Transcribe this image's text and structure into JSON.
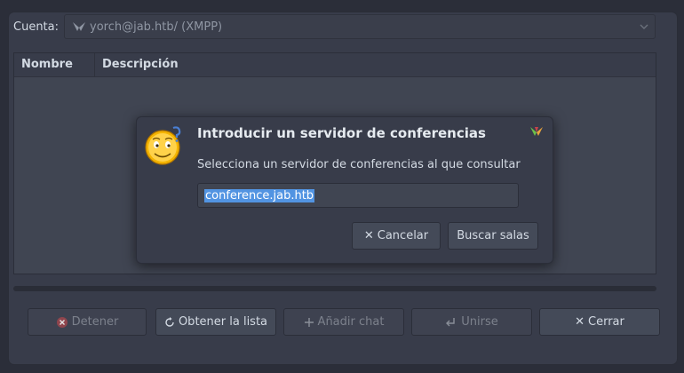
{
  "main": {
    "account_label": "Cuenta:",
    "account_value": "yorch@jab.htb/ (XMPP)",
    "columns": [
      "Nombre",
      "Descripción"
    ]
  },
  "buttons": {
    "stop": "Detener",
    "get_list": "Obtener la lista",
    "add_chat": "Añadir chat",
    "join": "Unirse",
    "close": "Cerrar"
  },
  "dialog": {
    "title": "Introducir un servidor de conferencias",
    "message": "Selecciona un servidor de conferencias al que consultar",
    "input_value": "conference.jab.htb",
    "cancel_label": "Cancelar",
    "search_label": "Buscar salas"
  },
  "colors": {
    "selection": "#5294e2",
    "window_bg": "#383c4a",
    "list_bg": "#404552"
  }
}
